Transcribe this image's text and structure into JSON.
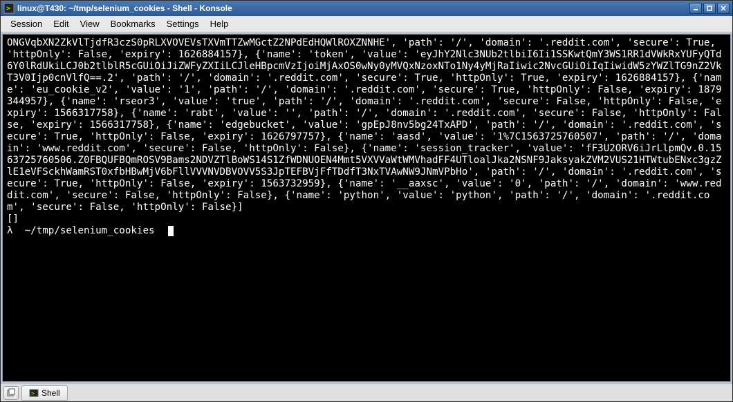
{
  "window": {
    "title": "linux@T430: ~/tmp/selenium_cookies - Shell - Konsole"
  },
  "menu": {
    "session": "Session",
    "edit": "Edit",
    "view": "View",
    "bookmarks": "Bookmarks",
    "settings": "Settings",
    "help": "Help"
  },
  "terminal": {
    "output": "ONGVqbXN2ZkVlTjdfR3czS0pRLXVOVEVsTXVmTTZwMGctZ2NPdEdHQWlROXZNNHE', 'path': '/', 'domain': '.reddit.com', 'secure': True, 'httpOnly': False, 'expiry': 1626884157}, {'name': 'token', 'value': 'eyJhY2Nlc3NUb2tlbiI6Ii1SSKwtQmY3WS1RR1dVWkRxYUFyQTd6Y0lRdUkiLCJ0b2tlblR5cGUiOiJiZWFyZXIiLCJleHBpcmVzIjoiMjAxOS0wNy0yMVQxNzoxNTo1Ny4yMjRaIiwic2NvcGUiOiIqIiwidW5zYWZlTG9nZ2VkT3V0Ijp0cnVlfQ==.2', 'path': '/', 'domain': '.reddit.com', 'secure': True, 'httpOnly': True, 'expiry': 1626884157}, {'name': 'eu_cookie_v2', 'value': '1', 'path': '/', 'domain': '.reddit.com', 'secure': True, 'httpOnly': False, 'expiry': 1879344957}, {'name': 'rseor3', 'value': 'true', 'path': '/', 'domain': '.reddit.com', 'secure': False, 'httpOnly': False, 'expiry': 1566317758}, {'name': 'rabt', 'value': '', 'path': '/', 'domain': '.reddit.com', 'secure': False, 'httpOnly': False, 'expiry': 1566317758}, {'name': 'edgebucket', 'value': 'gpEpJ8nv5bg24TxAPD', 'path': '/', 'domain': '.reddit.com', 'secure': True, 'httpOnly': False, 'expiry': 1626797757}, {'name': 'aasd', 'value': '1%7C1563725760507', 'path': '/', 'domain': 'www.reddit.com', 'secure': False, 'httpOnly': False}, {'name': 'session_tracker', 'value': 'fF3U2ORV6iJrLlpmQv.0.1563725760506.Z0FBQUFBQmROSV9Bams2NDVZTlBoWS14S1ZfWDNUOEN4Mmt5VXVVaWtWMVhadFF4UTloalJka2NSNF9JaksyakZVM2VUS21HTWtubENxc3gzZlE1eVFSckhWamRST0xfbHBwMjV6bFllVVVNVDBVOVV5S3JpTEFBVjFfTDdfT3NxTVAwNW9JNmVPbHo', 'path': '/', 'domain': '.reddit.com', 'secure': True, 'httpOnly': False, 'expiry': 1563732959}, {'name': '__aaxsc', 'value': '0', 'path': '/', 'domain': 'www.reddit.com', 'secure': False, 'httpOnly': False}, {'name': 'python', 'value': 'python', 'path': '/', 'domain': '.reddit.com', 'secure': False, 'httpOnly': False}]\n[]",
    "prompt_symbol": "λ",
    "prompt_path": "~/tmp/selenium_cookies"
  },
  "tab": {
    "label": "Shell"
  }
}
